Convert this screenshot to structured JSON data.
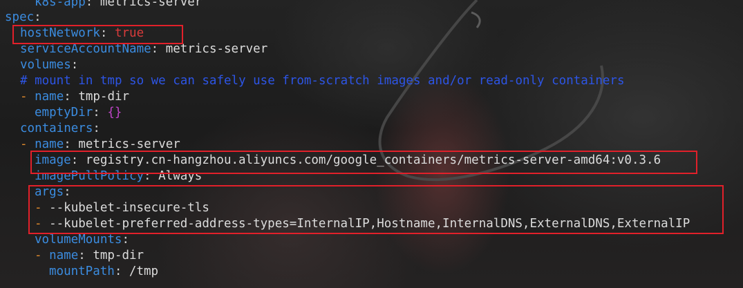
{
  "lines": {
    "l0": {
      "key": "k8s-app",
      "value": "metrics-server"
    },
    "l1": {
      "key": "spec"
    },
    "l2": {
      "key": "hostNetwork",
      "value": "true"
    },
    "l3": {
      "key": "serviceAccountName",
      "value": "metrics-server"
    },
    "l4": {
      "key": "volumes"
    },
    "l5": {
      "comment": "# mount in tmp so we can safely use from-scratch images and/or read-only containers"
    },
    "l6": {
      "dash": "-",
      "key": "name",
      "value": "tmp-dir"
    },
    "l7": {
      "key": "emptyDir",
      "value": "{}"
    },
    "l8": {
      "key": "containers"
    },
    "l9": {
      "dash": "-",
      "key": "name",
      "value": "metrics-server"
    },
    "l10": {
      "key": "image",
      "value": "registry.cn-hangzhou.aliyuncs.com/google_containers/metrics-server-amd64:v0.3.6"
    },
    "l11": {
      "key": "imagePullPolicy",
      "value": "Always"
    },
    "l12": {
      "key": "args"
    },
    "l13": {
      "dash": "-",
      "value": "--kubelet-insecure-tls"
    },
    "l14": {
      "dash": "-",
      "value": "--kubelet-preferred-address-types=InternalIP,Hostname,InternalDNS,ExternalDNS,ExternalIP"
    },
    "l15": {
      "key": "volumeMounts"
    },
    "l16": {
      "dash": "-",
      "key": "name",
      "value": "tmp-dir"
    },
    "l17": {
      "key": "mountPath",
      "value": "/tmp"
    }
  },
  "colors": {
    "key": "#3b8ce0",
    "comment": "#2d55e6",
    "boolean": "#d83b3b",
    "dash": "#e08a2c",
    "brace": "#c045c8",
    "highlight_box": "#e2202a"
  }
}
